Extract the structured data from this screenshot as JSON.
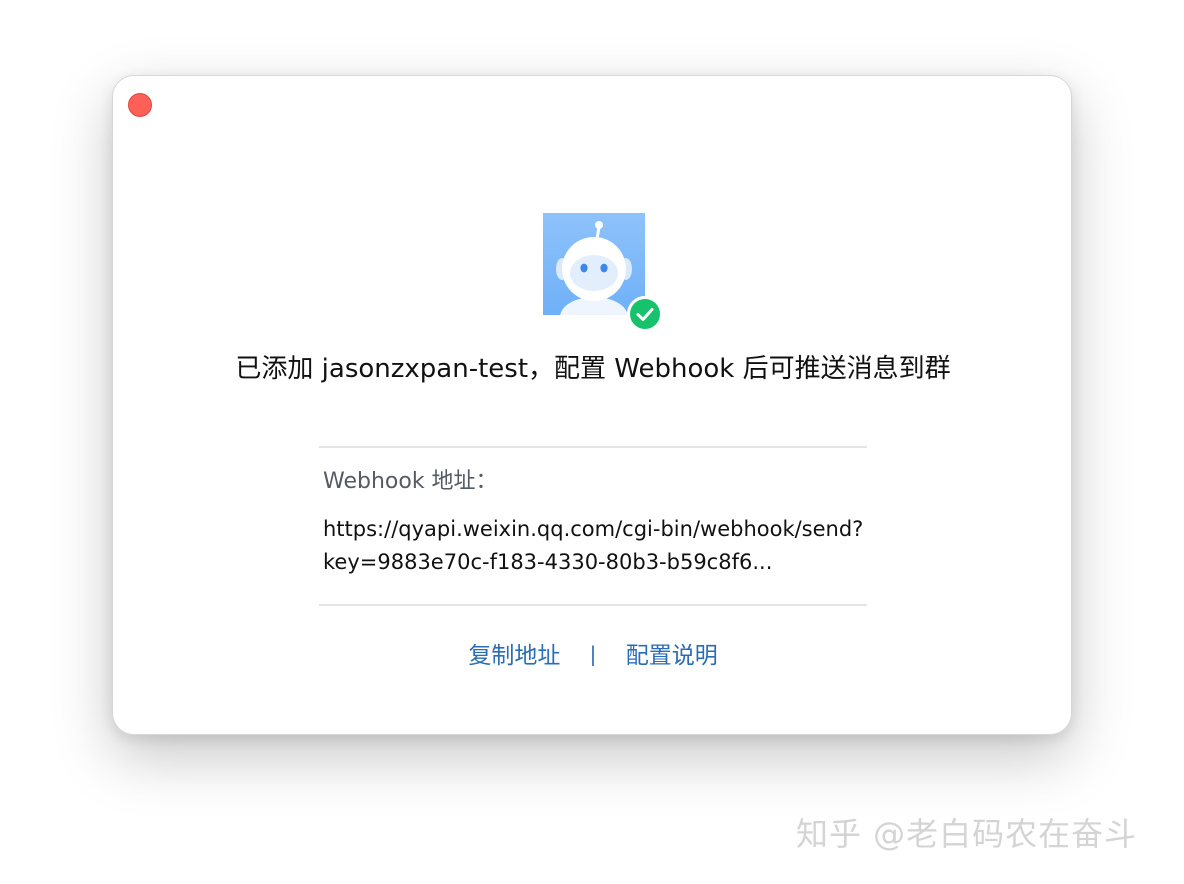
{
  "dialog": {
    "message": "已添加 jasonzxpan-test，配置 Webhook 后可推送消息到群",
    "webhook_label": "Webhook 地址：",
    "webhook_url_display": "https://qyapi.weixin.qq.com/cgi-bin/webhook/send?key=9883e70c-f183-4330-80b3-b59c8f6...",
    "copy_link_label": "复制地址",
    "separator": "|",
    "config_help_label": "配置说明"
  },
  "icons": {
    "close": "close-icon",
    "avatar": "robot-avatar-icon",
    "badge": "check-icon"
  },
  "colors": {
    "close_button": "#fe5f57",
    "badge_green": "#16c36c",
    "link_blue": "#2a6cb6",
    "avatar_bg": "#8ec2fb"
  },
  "watermark": {
    "text": "知乎 @老白码农在奋斗"
  }
}
